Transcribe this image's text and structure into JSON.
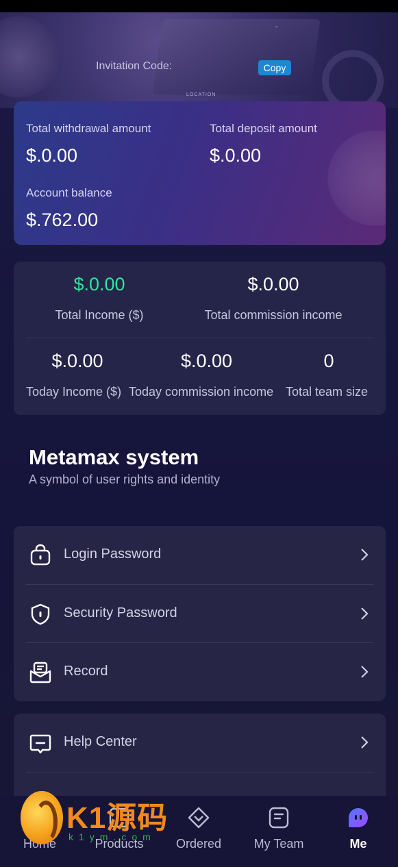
{
  "hero": {
    "invitation_label": "Invitation Code:",
    "invitation_code": "",
    "copy_label": "Copy",
    "location_text": "LOCATION",
    "dash": "-"
  },
  "balances": {
    "withdraw_label": "Total withdrawal amount",
    "withdraw_value": "$.0.00",
    "deposit_label": "Total deposit amount",
    "deposit_value": "$.0.00",
    "balance_label": "Account balance",
    "balance_value": "$.762.00"
  },
  "stats": {
    "total_income_value": "$.0.00",
    "total_income_label": "Total Income ($)",
    "total_commission_value": "$.0.00",
    "total_commission_label": "Total commission income",
    "today_income_value": "$.0.00",
    "today_income_label": "Today Income ($)",
    "today_commission_value": "$.0.00",
    "today_commission_label": "Today commission income",
    "team_size_value": "0",
    "team_size_label": "Total team size"
  },
  "system": {
    "title": "Metamax system",
    "subtitle": "A symbol of user rights and identity"
  },
  "menu1": [
    {
      "label": "Login Password",
      "icon": "lock-icon"
    },
    {
      "label": "Security Password",
      "icon": "shield-icon"
    },
    {
      "label": "Record",
      "icon": "record-icon"
    }
  ],
  "menu2": [
    {
      "label": "Help Center",
      "icon": "help-chat-icon"
    }
  ],
  "nav": [
    {
      "label": "Home",
      "icon": "home-icon"
    },
    {
      "label": "Products",
      "icon": "products-icon"
    },
    {
      "label": "Ordered",
      "icon": "ordered-icon"
    },
    {
      "label": "My Team",
      "icon": "team-icon"
    },
    {
      "label": "Me",
      "icon": "me-icon",
      "active": true
    }
  ],
  "watermark": {
    "text": "K1源码",
    "sub": "k1ym.com"
  },
  "colors": {
    "accent_green": "#2ee59d",
    "copy_blue": "#1f86d6",
    "active_icon": "#7b4dff"
  }
}
